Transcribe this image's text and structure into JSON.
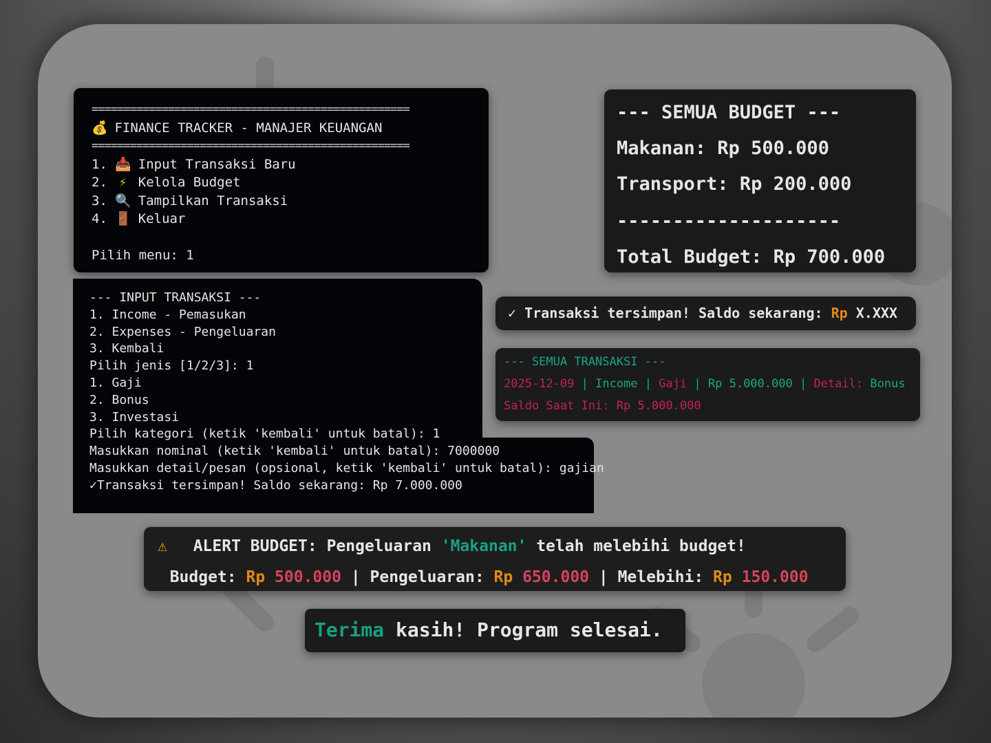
{
  "menu": {
    "separator": "==================================================",
    "title": "FINANCE TRACKER - MANAJER KEUANGAN",
    "items": [
      {
        "num": "1.",
        "label": "Input Transaksi Baru",
        "icon": "inbox-tray-icon"
      },
      {
        "num": "2.",
        "label": "Kelola Budget",
        "icon": "lightning-icon"
      },
      {
        "num": "3.",
        "label": "Tampilkan Transaksi",
        "icon": "magnifier-icon"
      },
      {
        "num": "4.",
        "label": "Keluar",
        "icon": "door-icon"
      }
    ],
    "prompt": "Pilih menu: 1"
  },
  "input_panel": {
    "lines": [
      "--- INPUT TRANSAKSI ---",
      "1. Income - Pemasukan",
      "2. Expenses - Pengeluaran",
      "3. Kembali",
      "Pilih jenis [1/2/3]: 1",
      "1. Gaji",
      "2. Bonus",
      "3. Investasi",
      "Pilih kategori (ketik 'kembali' untuk batal): 1",
      "Masukkan nominal (ketik 'kembali' untuk batal): 7000000",
      "Masukkan detail/pesan (opsional, ketik 'kembali' untuk batal): gajian",
      "✓Transaksi tersimpan! Saldo sekarang: Rp 7.000.000"
    ]
  },
  "budget_panel": {
    "title": "--- SEMUA BUDGET ---",
    "rows": [
      "Makanan: Rp 500.000",
      "Transport: Rp 200.000"
    ],
    "divider": "--------------------",
    "total": "Total Budget: Rp 700.000"
  },
  "saved_panel": {
    "check": "✓",
    "text": " Transaksi tersimpan! Saldo sekarang: ",
    "currency": "Rp",
    "amount": " X.XXX"
  },
  "transactions_panel": {
    "title": "--- SEMUA TRANSAKSI ---",
    "row": {
      "date": "2025-12-09",
      "sep": " | ",
      "type": "Income",
      "category": "Gaji",
      "amount": "Rp 5.000.000",
      "detail_label": "Detail: ",
      "detail": "Bonus"
    },
    "balance": "Saldo Saat Ini: Rp 5.000.000"
  },
  "alert_panel": {
    "icon": "warning-icon",
    "prefix": "ALERT BUDGET: Pengeluaran ",
    "category": "'Makanan'",
    "suffix": " telah melebihi budget!",
    "budget_label": "Budget: ",
    "budget_cur": "Rp",
    "budget_val": " 500.000",
    "pipe": " | ",
    "spent_label": "Pengeluaran: ",
    "spent_cur": "Rp",
    "spent_val": " 650.000",
    "over_label": "Melebihi: ",
    "over_cur": "Rp",
    "over_val": " 150.000"
  },
  "bye_panel": {
    "first": "Terima",
    "rest": " kasih! Program selesai."
  }
}
